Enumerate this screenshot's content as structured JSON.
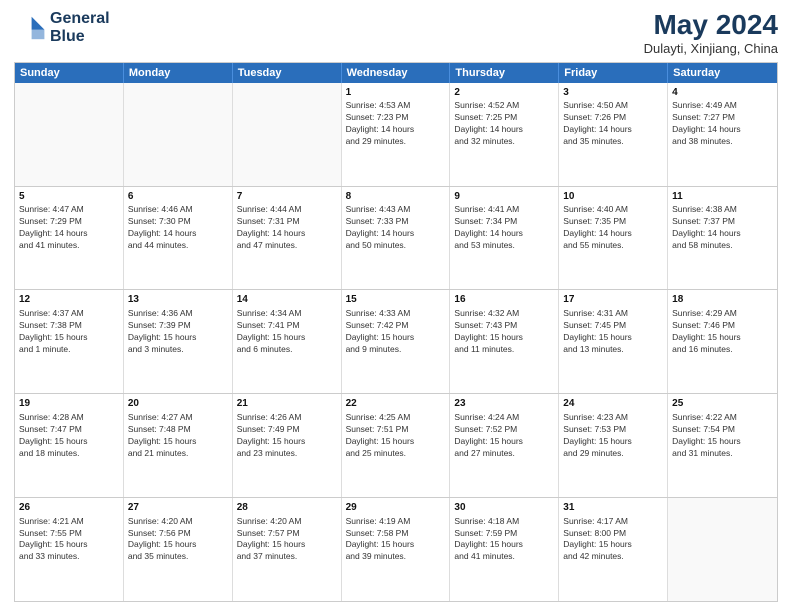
{
  "header": {
    "logo_line1": "General",
    "logo_line2": "Blue",
    "main_title": "May 2024",
    "subtitle": "Dulayti, Xinjiang, China"
  },
  "days_of_week": [
    "Sunday",
    "Monday",
    "Tuesday",
    "Wednesday",
    "Thursday",
    "Friday",
    "Saturday"
  ],
  "weeks": [
    [
      {
        "day": "",
        "info": ""
      },
      {
        "day": "",
        "info": ""
      },
      {
        "day": "",
        "info": ""
      },
      {
        "day": "1",
        "info": "Sunrise: 4:53 AM\nSunset: 7:23 PM\nDaylight: 14 hours\nand 29 minutes."
      },
      {
        "day": "2",
        "info": "Sunrise: 4:52 AM\nSunset: 7:25 PM\nDaylight: 14 hours\nand 32 minutes."
      },
      {
        "day": "3",
        "info": "Sunrise: 4:50 AM\nSunset: 7:26 PM\nDaylight: 14 hours\nand 35 minutes."
      },
      {
        "day": "4",
        "info": "Sunrise: 4:49 AM\nSunset: 7:27 PM\nDaylight: 14 hours\nand 38 minutes."
      }
    ],
    [
      {
        "day": "5",
        "info": "Sunrise: 4:47 AM\nSunset: 7:29 PM\nDaylight: 14 hours\nand 41 minutes."
      },
      {
        "day": "6",
        "info": "Sunrise: 4:46 AM\nSunset: 7:30 PM\nDaylight: 14 hours\nand 44 minutes."
      },
      {
        "day": "7",
        "info": "Sunrise: 4:44 AM\nSunset: 7:31 PM\nDaylight: 14 hours\nand 47 minutes."
      },
      {
        "day": "8",
        "info": "Sunrise: 4:43 AM\nSunset: 7:33 PM\nDaylight: 14 hours\nand 50 minutes."
      },
      {
        "day": "9",
        "info": "Sunrise: 4:41 AM\nSunset: 7:34 PM\nDaylight: 14 hours\nand 53 minutes."
      },
      {
        "day": "10",
        "info": "Sunrise: 4:40 AM\nSunset: 7:35 PM\nDaylight: 14 hours\nand 55 minutes."
      },
      {
        "day": "11",
        "info": "Sunrise: 4:38 AM\nSunset: 7:37 PM\nDaylight: 14 hours\nand 58 minutes."
      }
    ],
    [
      {
        "day": "12",
        "info": "Sunrise: 4:37 AM\nSunset: 7:38 PM\nDaylight: 15 hours\nand 1 minute."
      },
      {
        "day": "13",
        "info": "Sunrise: 4:36 AM\nSunset: 7:39 PM\nDaylight: 15 hours\nand 3 minutes."
      },
      {
        "day": "14",
        "info": "Sunrise: 4:34 AM\nSunset: 7:41 PM\nDaylight: 15 hours\nand 6 minutes."
      },
      {
        "day": "15",
        "info": "Sunrise: 4:33 AM\nSunset: 7:42 PM\nDaylight: 15 hours\nand 9 minutes."
      },
      {
        "day": "16",
        "info": "Sunrise: 4:32 AM\nSunset: 7:43 PM\nDaylight: 15 hours\nand 11 minutes."
      },
      {
        "day": "17",
        "info": "Sunrise: 4:31 AM\nSunset: 7:45 PM\nDaylight: 15 hours\nand 13 minutes."
      },
      {
        "day": "18",
        "info": "Sunrise: 4:29 AM\nSunset: 7:46 PM\nDaylight: 15 hours\nand 16 minutes."
      }
    ],
    [
      {
        "day": "19",
        "info": "Sunrise: 4:28 AM\nSunset: 7:47 PM\nDaylight: 15 hours\nand 18 minutes."
      },
      {
        "day": "20",
        "info": "Sunrise: 4:27 AM\nSunset: 7:48 PM\nDaylight: 15 hours\nand 21 minutes."
      },
      {
        "day": "21",
        "info": "Sunrise: 4:26 AM\nSunset: 7:49 PM\nDaylight: 15 hours\nand 23 minutes."
      },
      {
        "day": "22",
        "info": "Sunrise: 4:25 AM\nSunset: 7:51 PM\nDaylight: 15 hours\nand 25 minutes."
      },
      {
        "day": "23",
        "info": "Sunrise: 4:24 AM\nSunset: 7:52 PM\nDaylight: 15 hours\nand 27 minutes."
      },
      {
        "day": "24",
        "info": "Sunrise: 4:23 AM\nSunset: 7:53 PM\nDaylight: 15 hours\nand 29 minutes."
      },
      {
        "day": "25",
        "info": "Sunrise: 4:22 AM\nSunset: 7:54 PM\nDaylight: 15 hours\nand 31 minutes."
      }
    ],
    [
      {
        "day": "26",
        "info": "Sunrise: 4:21 AM\nSunset: 7:55 PM\nDaylight: 15 hours\nand 33 minutes."
      },
      {
        "day": "27",
        "info": "Sunrise: 4:20 AM\nSunset: 7:56 PM\nDaylight: 15 hours\nand 35 minutes."
      },
      {
        "day": "28",
        "info": "Sunrise: 4:20 AM\nSunset: 7:57 PM\nDaylight: 15 hours\nand 37 minutes."
      },
      {
        "day": "29",
        "info": "Sunrise: 4:19 AM\nSunset: 7:58 PM\nDaylight: 15 hours\nand 39 minutes."
      },
      {
        "day": "30",
        "info": "Sunrise: 4:18 AM\nSunset: 7:59 PM\nDaylight: 15 hours\nand 41 minutes."
      },
      {
        "day": "31",
        "info": "Sunrise: 4:17 AM\nSunset: 8:00 PM\nDaylight: 15 hours\nand 42 minutes."
      },
      {
        "day": "",
        "info": ""
      }
    ]
  ]
}
